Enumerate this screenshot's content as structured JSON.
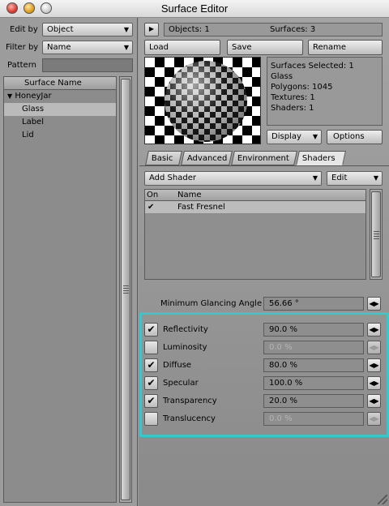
{
  "window": {
    "title": "Surface Editor"
  },
  "left": {
    "edit_by_label": "Edit by",
    "edit_by_value": "Object",
    "filter_by_label": "Filter by",
    "filter_by_value": "Name",
    "pattern_label": "Pattern",
    "pattern_value": "",
    "tree_header": "Surface Name",
    "root": "HoneyJar",
    "items": [
      "Glass",
      "Label",
      "Lid"
    ],
    "selected": "Glass"
  },
  "top": {
    "objects": "Objects: 1",
    "surfaces": "Surfaces: 3",
    "load": "Load",
    "save": "Save",
    "rename": "Rename"
  },
  "info": {
    "surfaces_selected": "Surfaces Selected: 1",
    "name": "Glass",
    "polygons": "Polygons: 1045",
    "textures": "Textures: 1",
    "shaders": "Shaders: 1"
  },
  "preview_controls": {
    "display": "Display",
    "options": "Options"
  },
  "tabs": [
    "Basic",
    "Advanced",
    "Environment",
    "Shaders"
  ],
  "active_tab": "Shaders",
  "shader": {
    "add_shader": "Add Shader",
    "edit": "Edit",
    "col_on": "On",
    "col_name": "Name",
    "rows": [
      {
        "on": "✔",
        "name": "Fast Fresnel"
      }
    ],
    "min_angle_label": "Minimum Glancing Angle",
    "min_angle_value": "56.66 °"
  },
  "channels": [
    {
      "label": "Reflectivity",
      "value": "90.0 %",
      "checked": true
    },
    {
      "label": "Luminosity",
      "value": "0.0 %",
      "checked": false
    },
    {
      "label": "Diffuse",
      "value": "80.0 %",
      "checked": true
    },
    {
      "label": "Specular",
      "value": "100.0 %",
      "checked": true
    },
    {
      "label": "Transparency",
      "value": "20.0 %",
      "checked": true
    },
    {
      "label": "Translucency",
      "value": "0.0 %",
      "checked": false
    }
  ],
  "icons": {
    "check": "✔",
    "arrow_right": "▶",
    "arrow_down": "▼",
    "tree_open": "▼",
    "stepper": "◀▶"
  },
  "colors": {
    "highlight_border": "#33c9d1"
  }
}
